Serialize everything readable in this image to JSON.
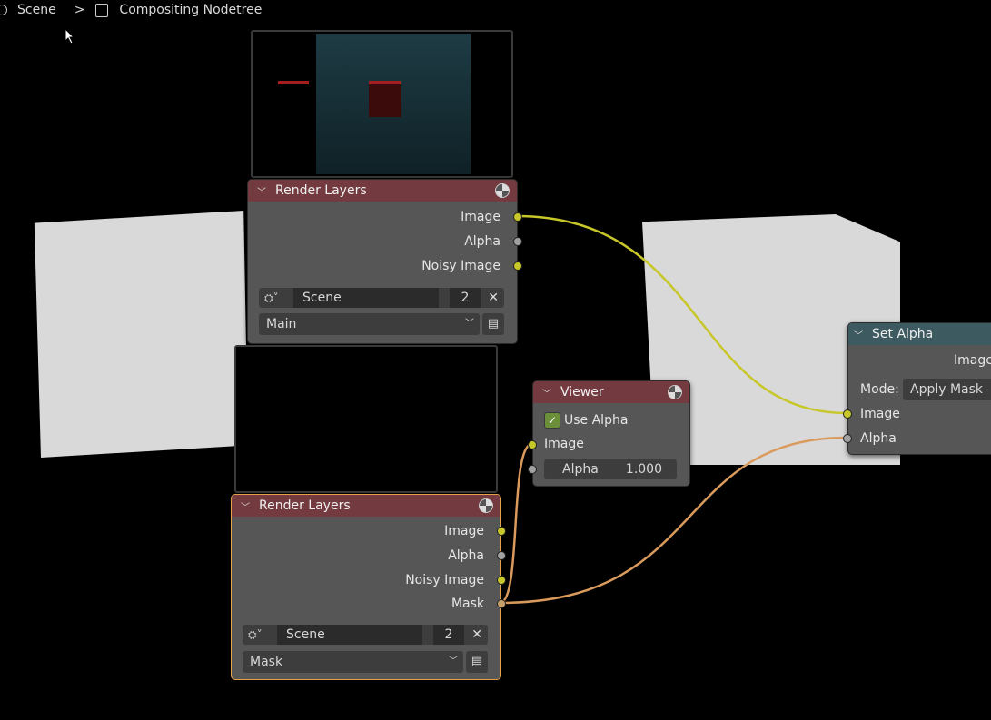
{
  "breadcrumb": {
    "scene_label": "Scene",
    "separator": ">",
    "nodetree_label": "Compositing Nodetree"
  },
  "render_layers_1": {
    "title": "Render Layers",
    "outputs": [
      "Image",
      "Alpha",
      "Noisy Image"
    ],
    "scene_value": "Scene",
    "scene_users": "2",
    "layer_value": "Main"
  },
  "render_layers_2": {
    "title": "Render Layers",
    "outputs": [
      "Image",
      "Alpha",
      "Noisy Image",
      "Mask"
    ],
    "scene_value": "Scene",
    "scene_users": "2",
    "layer_value": "Mask"
  },
  "viewer": {
    "title": "Viewer",
    "use_alpha_label": "Use Alpha",
    "use_alpha_checked": true,
    "image_label": "Image",
    "alpha_label": "Alpha",
    "alpha_value": "1.000"
  },
  "set_alpha": {
    "title": "Set Alpha",
    "output_label": "Image",
    "mode_label": "Mode:",
    "mode_value": "Apply Mask",
    "image_label": "Image",
    "alpha_label": "Alpha"
  },
  "colors": {
    "header_red": "#733a3f",
    "header_teal": "#3d5a61",
    "link_yellow": "#c7c729",
    "link_orange": "#d99a5c",
    "active_border": "#e8a04a"
  }
}
